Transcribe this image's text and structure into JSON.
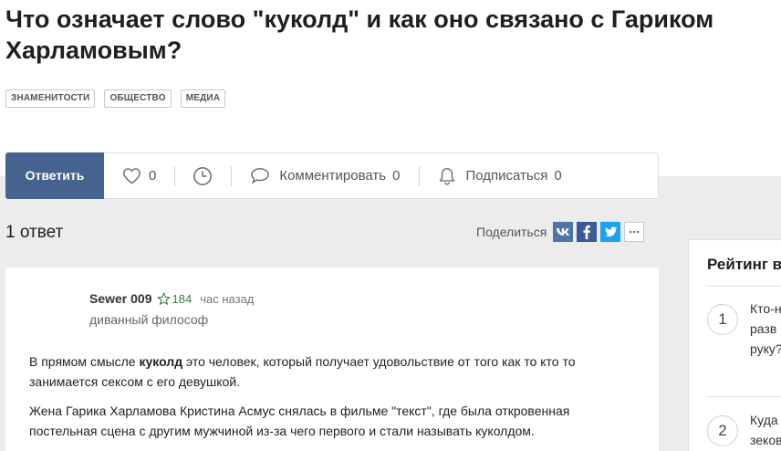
{
  "question": {
    "title": "Что означает слово \"куколд\" и как оно связано с Гариком Харламовым?",
    "tags": [
      "ЗНАМЕНИТОСТИ",
      "ОБЩЕСТВО",
      "МЕДИА"
    ]
  },
  "actions": {
    "answer_label": "Ответить",
    "likes_count": "0",
    "comment_label": "Комментировать",
    "comment_count": "0",
    "subscribe_label": "Подписаться",
    "subscribe_count": "0"
  },
  "answers": {
    "count_label": "1 ответ",
    "share_label": "Поделиться",
    "social": [
      {
        "name": "vk-icon",
        "glyph": "vk",
        "color": "#4a76a8"
      },
      {
        "name": "facebook-icon",
        "glyph": "f",
        "color": "#3b5998"
      },
      {
        "name": "twitter-icon",
        "glyph": "t",
        "color": "#1da1f2"
      },
      {
        "name": "more-icon",
        "glyph": "•••",
        "color": "#ffffff"
      }
    ]
  },
  "answer": {
    "author": "Sewer 009",
    "rating": "184",
    "time": "час назад",
    "role": "диванный философ",
    "p1_before": "В прямом смысле ",
    "p1_bold": "куколд",
    "p1_after": " это человек, который получает удовольствие от того как то кто то занимается сексом с его девушкой.",
    "p2": "Жена Гарика Харламова Кристина Асмус снялась в фильме \"текст\", где была откровенная постельная сцена с другим мужчиной из-за чего первого и стали называть куколдом."
  },
  "sidebar": {
    "title": "Рейтинг в",
    "items": [
      {
        "num": "1",
        "line1": "Кто-н",
        "line2": "разв",
        "line3": "руку?"
      },
      {
        "num": "2",
        "line1": "Куда",
        "line2": "зеков",
        "line3": ""
      }
    ]
  }
}
